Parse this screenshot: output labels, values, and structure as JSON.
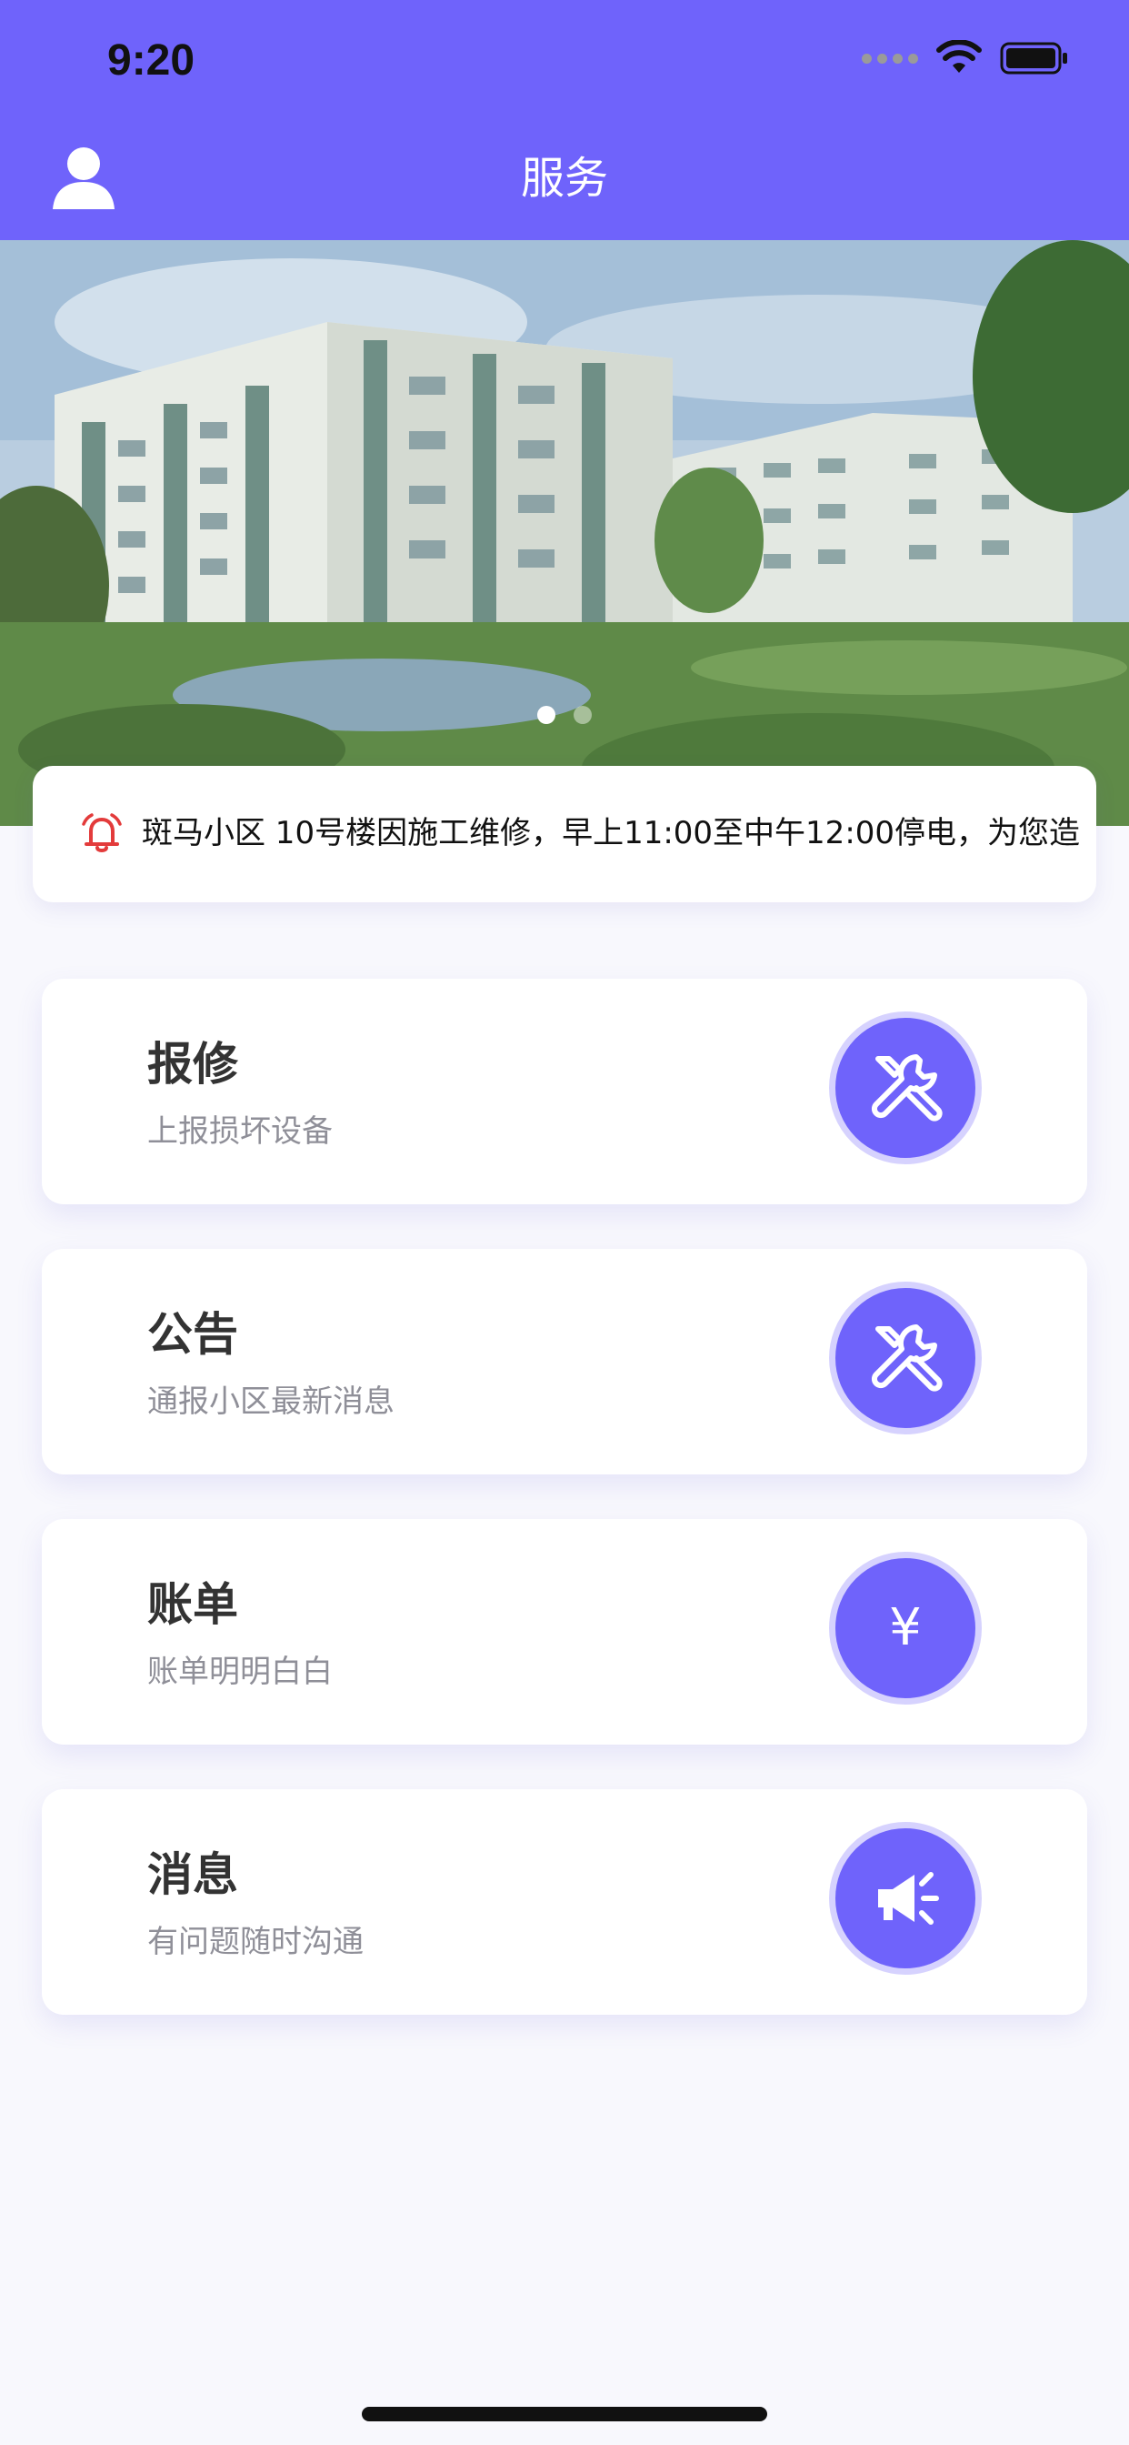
{
  "status_bar": {
    "time": "9:20"
  },
  "header": {
    "title": "服务",
    "icon": "user-icon"
  },
  "banner": {
    "slides_total": 2,
    "active_slide": 1
  },
  "notice": {
    "icon": "bell-icon",
    "text": "斑马小区 10号楼因施工维修，早上11:00至中午12:00停电，为您造"
  },
  "services": [
    {
      "title": "报修",
      "subtitle": "上报损坏设备",
      "icon": "wrench-screwdriver-icon"
    },
    {
      "title": "公告",
      "subtitle": "通报小区最新消息",
      "icon": "wrench-screwdriver-icon"
    },
    {
      "title": "账单",
      "subtitle": "账单明明白白",
      "icon": "yen-icon",
      "icon_glyph": "¥"
    },
    {
      "title": "消息",
      "subtitle": "有问题随时沟通",
      "icon": "megaphone-icon"
    }
  ],
  "colors": {
    "primary": "#6f63fb",
    "accent_ring": "#d6d2fe",
    "bell": "#e33b3b",
    "background": "#f8f8fd"
  }
}
